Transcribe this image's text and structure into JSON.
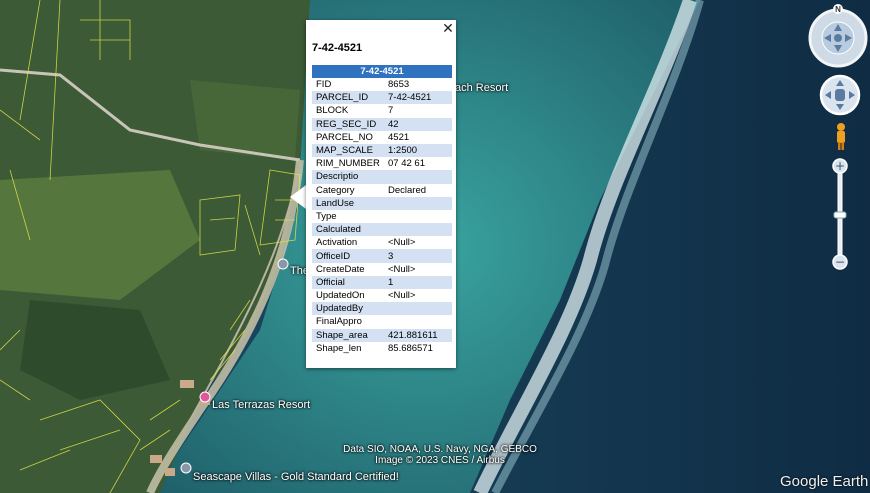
{
  "popup": {
    "title": "7-42-4521",
    "header": "7-42-4521",
    "close": "✕",
    "rows": [
      [
        "FID",
        "8653"
      ],
      [
        "PARCEL_ID",
        "7-42-4521"
      ],
      [
        "BLOCK",
        "7"
      ],
      [
        "REG_SEC_ID",
        "42"
      ],
      [
        "PARCEL_NO",
        "4521"
      ],
      [
        "MAP_SCALE",
        "1:2500"
      ],
      [
        "RIM_NUMBER",
        "07 42 61"
      ],
      [
        "Descriptio",
        ""
      ],
      [
        "Category",
        "Declared"
      ],
      [
        "LandUse",
        ""
      ],
      [
        "Type",
        ""
      ],
      [
        "Calculated",
        ""
      ],
      [
        "Activation",
        "<Null>"
      ],
      [
        "OfficeID",
        "3"
      ],
      [
        "CreateDate",
        "<Null>"
      ],
      [
        "Official",
        "1"
      ],
      [
        "UpdatedOn",
        "<Null>"
      ],
      [
        "UpdatedBy",
        ""
      ],
      [
        "FinalAppro",
        ""
      ],
      [
        "Shape_area",
        "421.881611"
      ],
      [
        "Shape_len",
        "85.686571"
      ]
    ]
  },
  "places": {
    "beach_resort": "ach Resort",
    "the": "The",
    "las_terrazas": "Las Terrazas Resort",
    "seascape": "Seascape Villas - Gold Standard Certified!"
  },
  "attribution": {
    "line1": "Data SIO, NOAA, U.S. Navy, NGA, GEBCO",
    "line2": "Image © 2023 CNES / Airbus"
  },
  "brand": "Google Earth",
  "controls": {
    "north": "N",
    "zoom_in": "+",
    "zoom_out": "−",
    "zoom_level": 0.5
  },
  "colors": {
    "land": "#3a5a34",
    "ocean": "#1a3650",
    "parcel_lines": "#e6e64a",
    "table_header": "#2f73c0",
    "table_alt_row": "#d4e1f2"
  }
}
